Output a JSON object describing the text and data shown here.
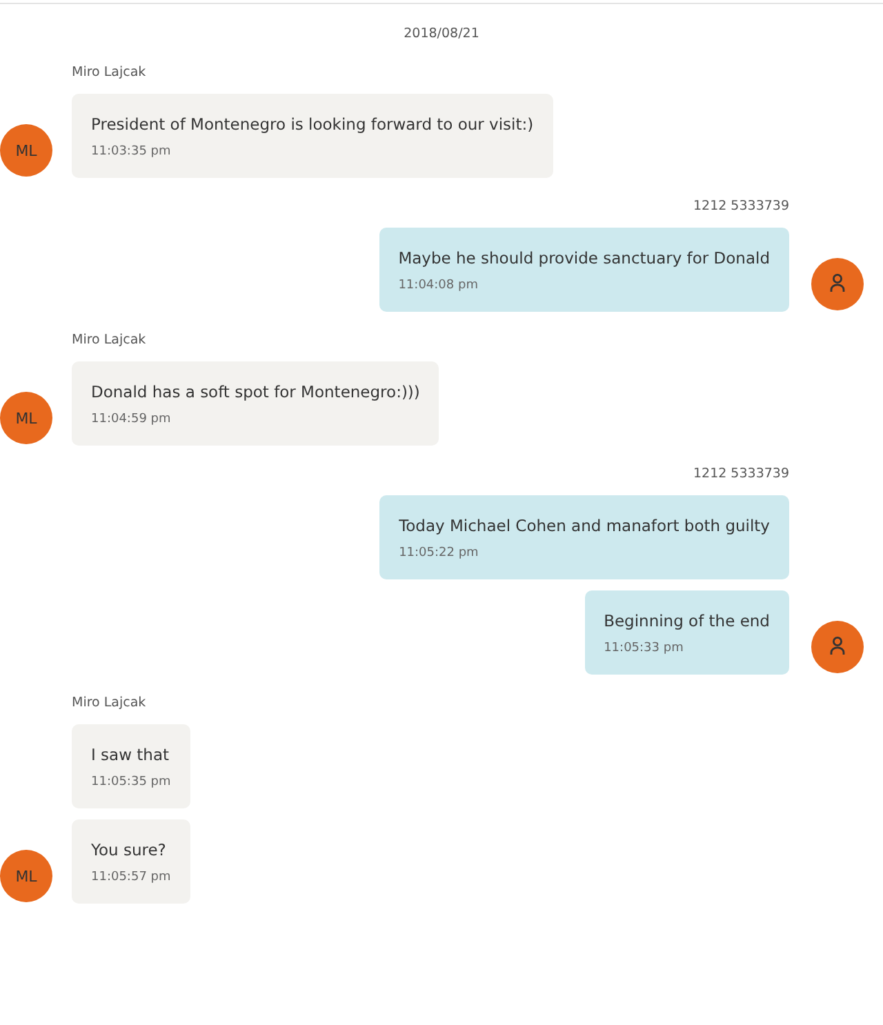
{
  "date": "2018/08/21",
  "groups": [
    {
      "kind": "incoming",
      "sender": "Miro Lajcak",
      "avatar": {
        "kind": "initials",
        "text": "ML"
      },
      "messages": [
        {
          "text": "President of Montenegro is looking forward to our visit:)",
          "time": "11:03:35 pm"
        }
      ]
    },
    {
      "kind": "outgoing",
      "sender": "1212 5333739",
      "avatar": {
        "kind": "person"
      },
      "messages": [
        {
          "text": "Maybe he should provide sanctuary for Donald",
          "time": "11:04:08 pm"
        }
      ]
    },
    {
      "kind": "incoming",
      "sender": "Miro Lajcak",
      "avatar": {
        "kind": "initials",
        "text": "ML"
      },
      "messages": [
        {
          "text": "Donald has a soft spot for Montenegro:)))",
          "time": "11:04:59 pm"
        }
      ]
    },
    {
      "kind": "outgoing",
      "sender": "1212 5333739",
      "avatar": {
        "kind": "person"
      },
      "messages": [
        {
          "text": "Today Michael Cohen and manafort both guilty",
          "time": "11:05:22 pm"
        },
        {
          "text": "Beginning of the end",
          "time": "11:05:33 pm"
        }
      ]
    },
    {
      "kind": "incoming",
      "sender": "Miro Lajcak",
      "avatar": {
        "kind": "initials",
        "text": "ML"
      },
      "messages": [
        {
          "text": "I saw that",
          "time": "11:05:35 pm"
        },
        {
          "text": "You sure?",
          "time": "11:05:57 pm"
        }
      ]
    }
  ]
}
